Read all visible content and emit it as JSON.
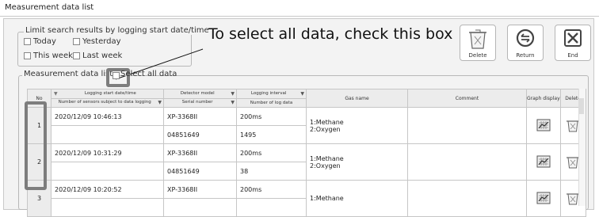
{
  "window": {
    "title": "Measurement data list"
  },
  "filter": {
    "group_label": "Limit search results by logging start date/time",
    "today": "Today",
    "yesterday": "Yesterday",
    "this_week": "This week",
    "last_week": "Last week"
  },
  "annotation": {
    "text": "To select all data, check this box"
  },
  "toolbar": {
    "delete_label": "Delete",
    "return_label": "Return",
    "end_label": "End"
  },
  "list": {
    "group_label": "Measurement data list",
    "select_all_label": "Select all data",
    "headers": {
      "no": "No",
      "logging_start": "Logging start date/time",
      "sensors": "Number of sensors subject to data logging",
      "detector_model": "Detector model",
      "serial": "Serial number",
      "logging_interval": "Logging interval",
      "log_count": "Number of log data",
      "gas_name": "Gas name",
      "comment": "Comment",
      "graph": "Graph display",
      "delete": "Delete"
    },
    "rows": [
      {
        "no": "1",
        "start": "2020/12/09 10:46:13",
        "model": "XP-3368II",
        "serial": "04851649",
        "interval": "200ms",
        "count": "1495",
        "gas1": "1:Methane",
        "gas2": "2:Oxygen"
      },
      {
        "no": "2",
        "start": "2020/12/09 10:31:29",
        "model": "XP-3368II",
        "serial": "04851649",
        "interval": "200ms",
        "count": "38",
        "gas1": "1:Methane",
        "gas2": "2:Oxygen"
      },
      {
        "no": "3",
        "start": "2020/12/09 10:20:52",
        "model": "XP-3368II",
        "serial": "",
        "interval": "200ms",
        "count": "",
        "gas1": "1:Methane",
        "gas2": ""
      }
    ]
  }
}
